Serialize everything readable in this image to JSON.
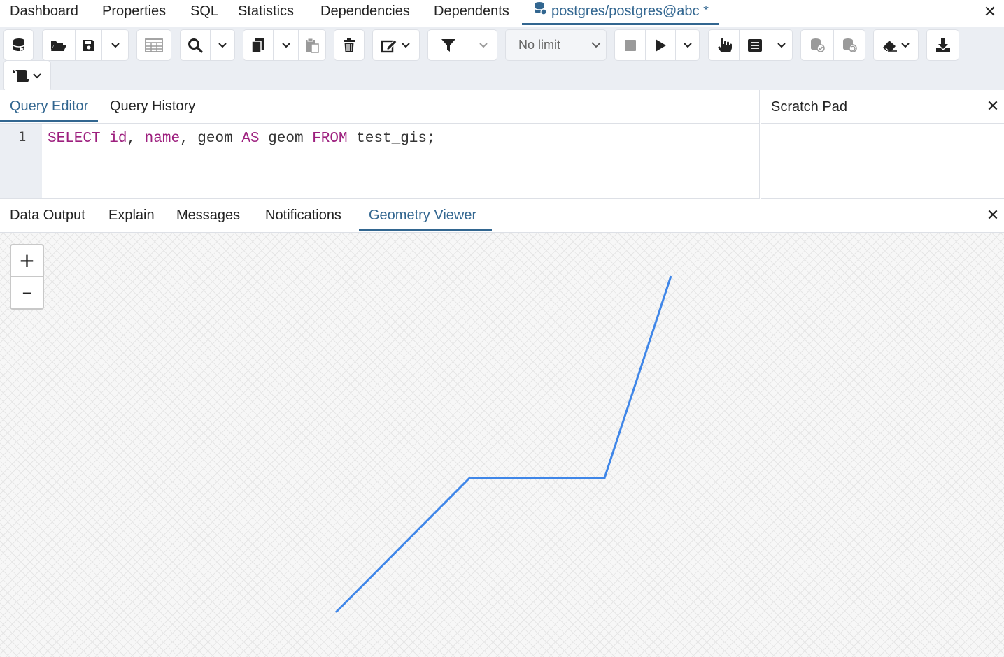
{
  "top_tabs": {
    "items": [
      "Dashboard",
      "Properties",
      "SQL",
      "Statistics",
      "Dependencies",
      "Dependents"
    ],
    "active_label": "postgres/postgres@abc *",
    "active_icon": "database-icon",
    "close_icon": "close-icon"
  },
  "toolbar": {
    "limit_value": "No limit",
    "accent": "#326690"
  },
  "editor": {
    "tabs": [
      "Query Editor",
      "Query History"
    ],
    "active_tab": "Query Editor",
    "line_number": "1",
    "code_tokens": [
      {
        "text": "SELECT",
        "kw": true
      },
      {
        "text": " ",
        "kw": false
      },
      {
        "text": "id",
        "kw": true
      },
      {
        "text": ", ",
        "kw": false
      },
      {
        "text": "name",
        "kw": true
      },
      {
        "text": ", geom ",
        "kw": false
      },
      {
        "text": "AS",
        "kw": true
      },
      {
        "text": " geom ",
        "kw": false
      },
      {
        "text": "FROM",
        "kw": true
      },
      {
        "text": " test_gis;",
        "kw": false
      }
    ]
  },
  "scratch_pad": {
    "title": "Scratch Pad"
  },
  "results": {
    "tabs": [
      "Data Output",
      "Explain",
      "Messages",
      "Notifications",
      "Geometry Viewer"
    ],
    "active_tab": "Geometry Viewer"
  },
  "geometry_viewer": {
    "zoom_in_label": "+",
    "zoom_out_label": "–",
    "line_color": "#3f86e8"
  }
}
